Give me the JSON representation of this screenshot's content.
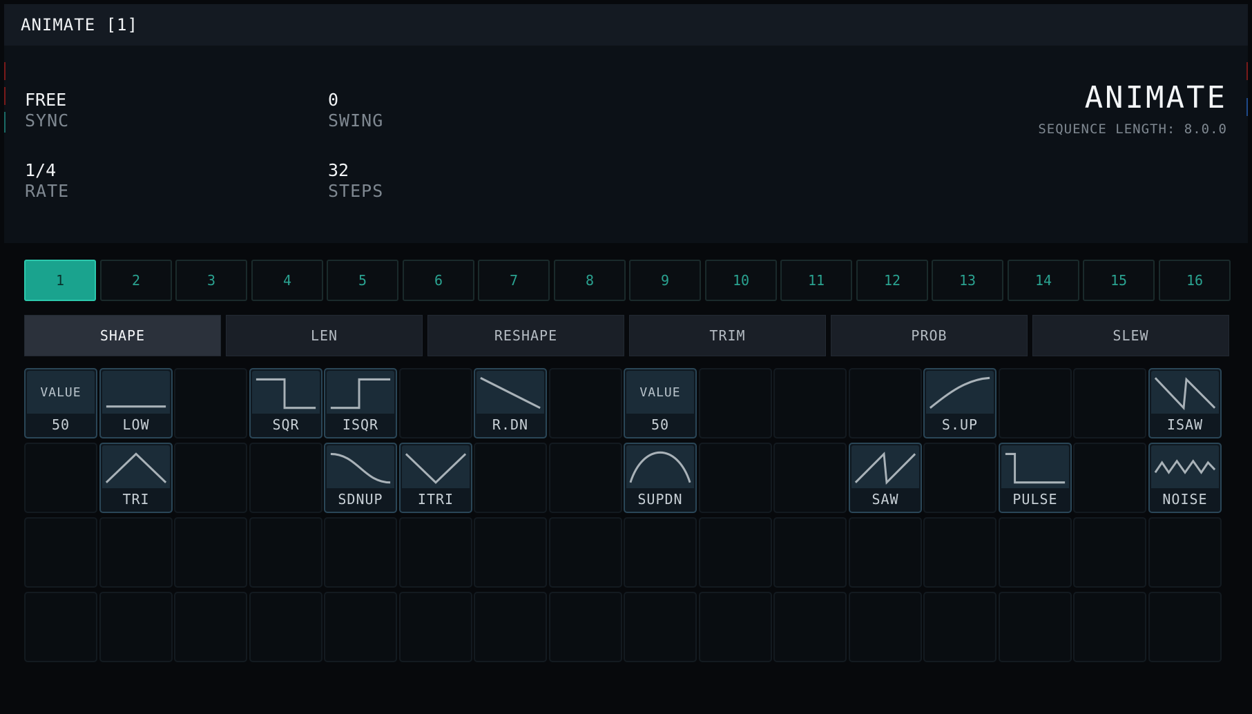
{
  "window": {
    "title": "ANIMATE [1]"
  },
  "header": {
    "params": [
      {
        "value": "FREE",
        "label": "SYNC"
      },
      {
        "value": "0",
        "label": "SWING"
      },
      {
        "value": "1/4",
        "label": "RATE"
      },
      {
        "value": "32",
        "label": "STEPS"
      }
    ],
    "title": "ANIMATE",
    "sequence_length": "SEQUENCE LENGTH: 8.0.0"
  },
  "pages": [
    "1",
    "2",
    "3",
    "4",
    "5",
    "6",
    "7",
    "8",
    "9",
    "10",
    "11",
    "12",
    "13",
    "14",
    "15",
    "16"
  ],
  "active_page": 0,
  "tabs": [
    "SHAPE",
    "LEN",
    "RESHAPE",
    "TRIM",
    "PROB",
    "SLEW"
  ],
  "active_tab": 0,
  "grid": {
    "row1": [
      {
        "col": 0,
        "top_text": "VALUE",
        "label": "50"
      },
      {
        "col": 1,
        "icon": "low-shape-icon",
        "label": "LOW"
      },
      {
        "col": 3,
        "icon": "square-shape-icon",
        "label": "SQR"
      },
      {
        "col": 4,
        "icon": "inverse-square-shape-icon",
        "label": "ISQR"
      },
      {
        "col": 6,
        "icon": "ramp-down-shape-icon",
        "label": "R.DN"
      },
      {
        "col": 8,
        "top_text": "VALUE",
        "label": "50"
      },
      {
        "col": 12,
        "icon": "smooth-up-shape-icon",
        "label": "S.UP"
      },
      {
        "col": 15,
        "icon": "inverse-saw-shape-icon",
        "label": "ISAW"
      }
    ],
    "row2": [
      {
        "col": 1,
        "icon": "triangle-shape-icon",
        "label": "TRI"
      },
      {
        "col": 4,
        "icon": "smooth-down-up-shape-icon",
        "label": "SDNUP"
      },
      {
        "col": 5,
        "icon": "inverse-triangle-shape-icon",
        "label": "ITRI"
      },
      {
        "col": 8,
        "icon": "smooth-up-down-shape-icon",
        "label": "SUPDN"
      },
      {
        "col": 11,
        "icon": "saw-shape-icon",
        "label": "SAW"
      },
      {
        "col": 13,
        "icon": "pulse-shape-icon",
        "label": "PULSE"
      },
      {
        "col": 15,
        "icon": "noise-shape-icon",
        "label": "NOISE"
      }
    ]
  },
  "colors": {
    "accent": "#1aa38e",
    "cell_fill": "#1b2c38",
    "cell_border": "#2a4657"
  }
}
